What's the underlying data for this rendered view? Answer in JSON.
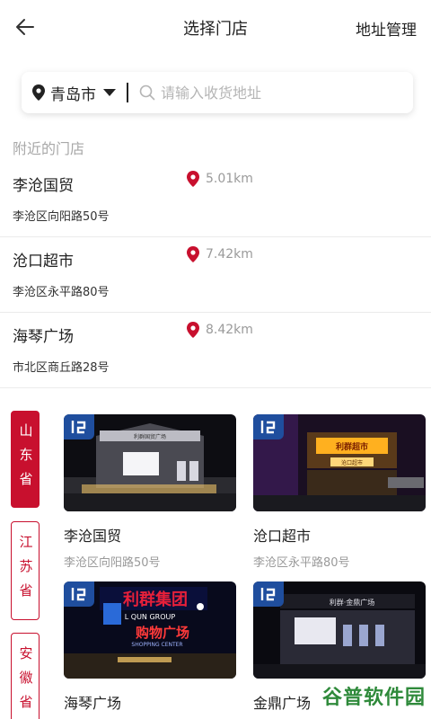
{
  "header": {
    "title": "选择门店",
    "right_action": "地址管理"
  },
  "search": {
    "city": "青岛市",
    "placeholder": "请输入收货地址"
  },
  "nearby": {
    "label": "附近的门店",
    "stores": [
      {
        "name": "李沧国贸",
        "distance": "5.01km",
        "address": "李沧区向阳路50号"
      },
      {
        "name": "沧口超市",
        "distance": "7.42km",
        "address": "李沧区永平路80号"
      },
      {
        "name": "海琴广场",
        "distance": "8.42km",
        "address": "市北区商丘路28号"
      }
    ]
  },
  "provinces": [
    {
      "label": "山东省",
      "active": true
    },
    {
      "label": "江苏省",
      "active": false
    },
    {
      "label": "安徽省",
      "active": false
    }
  ],
  "cards": [
    {
      "name": "李沧国贸",
      "address": "李沧区向阳路50号"
    },
    {
      "name": "沧口超市",
      "address": "李沧区永平路80号"
    },
    {
      "name": "海琴广场",
      "address": ""
    },
    {
      "name": "金鼎广场",
      "address": ""
    }
  ],
  "image_signs": {
    "card1": "利群国贸广场",
    "card2": "利群超市",
    "card2_sub": "沧口超市",
    "card3": "利群集团",
    "card3_sub": "L QUN GROUP",
    "card3_line": "购物广场",
    "card3_en": "SHOPPING CENTER",
    "card4": "利群·金鼎广场"
  },
  "watermark": "谷普软件园",
  "colors": {
    "brand_red": "#c8102e",
    "logo_blue": "#1f4e9e"
  }
}
